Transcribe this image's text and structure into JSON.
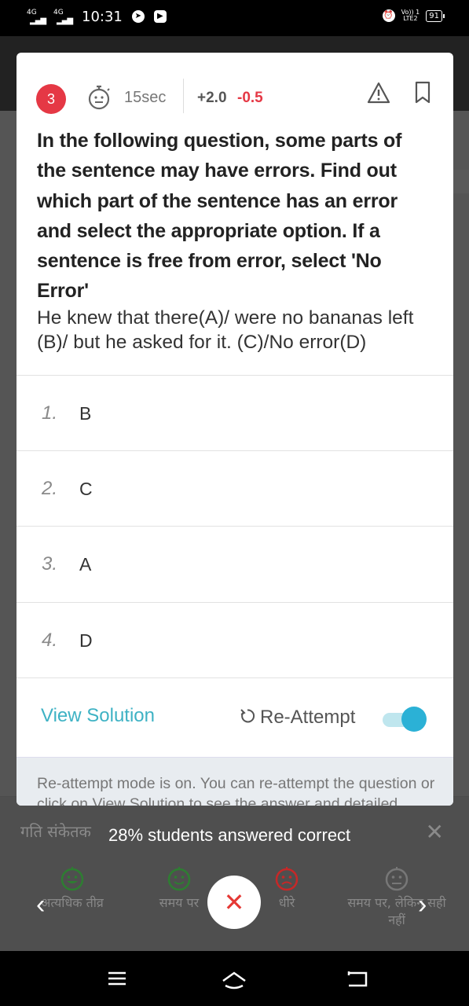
{
  "status_bar": {
    "network1": "4G",
    "network2": "4G",
    "time": "10:31",
    "volte": "Vo)) 1",
    "lte": "LTE2",
    "battery": "91"
  },
  "question_card": {
    "number": "3",
    "timer": "15sec",
    "marks_positive": "+2.0",
    "marks_negative": "-0.5",
    "question_text": "In the following question, some parts of the sentence may have errors. Find out which part of the sentence has an error and select the appropriate option. If a sentence is free from error, select 'No Error'",
    "sentence": "He knew that there(A)/ were no bananas left (B)/ but he asked for it. (C)/No error(D)",
    "options": [
      {
        "num": "1.",
        "label": "B"
      },
      {
        "num": "2.",
        "label": "C"
      },
      {
        "num": "3.",
        "label": "A"
      },
      {
        "num": "4.",
        "label": "D"
      }
    ],
    "view_solution": "View Solution",
    "reattempt": "Re-Attempt",
    "reattempt_toggle_on": true,
    "info_text": "Re-attempt mode is on. You can re-attempt the question or click on View Solution to see the answer and detailed"
  },
  "bottom_sheet": {
    "title_hindi": "गति संकेतक",
    "correct_text": "28% students answered correct",
    "speeds": [
      {
        "label": "अत्यधिक तीव्र",
        "color": "#2e7d32"
      },
      {
        "label": "समय पर",
        "color": "#2e7d32"
      },
      {
        "label": "धीरे",
        "color": "#c62828"
      },
      {
        "label": "समय पर, लेकिन सही नहीं",
        "color": "#777777"
      }
    ]
  },
  "colors": {
    "accent": "#3eb2c4",
    "number_badge": "#e53845",
    "toggle": "#2bb1d6"
  }
}
